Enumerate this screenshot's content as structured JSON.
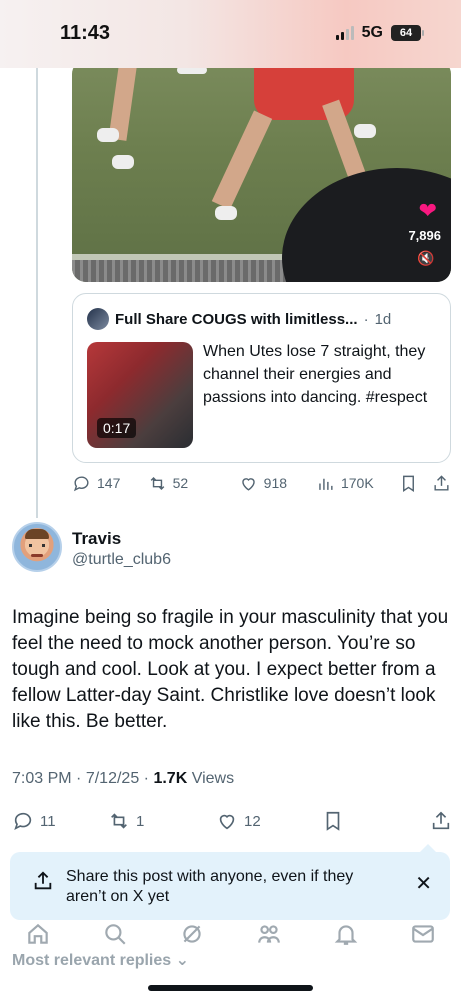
{
  "status_bar": {
    "time": "11:43",
    "network": "5G",
    "battery": "64"
  },
  "video": {
    "view_count": "7,896"
  },
  "quoted_tweet": {
    "name": "Full Share COUGS with limitless...",
    "separator": "·",
    "time": "1d",
    "duration": "0:17",
    "text": "When Utes lose 7 straight, they channel their energies and passions into dancing. #respect"
  },
  "parent_actions": {
    "replies": "147",
    "reposts": "52",
    "likes": "918",
    "views": "170K"
  },
  "reply": {
    "name": "Travis",
    "handle": "@turtle_club6",
    "text": "Imagine being so fragile in your masculinity that you feel the need to mock another person. You’re so tough and cool. Look at you. I expect better from a fellow Latter-day Saint. Christlike love doesn’t look like this. Be better.",
    "time": "7:03 PM",
    "date": "7/12/25",
    "dot": "·",
    "views_count": "1.7K",
    "views_label": "Views"
  },
  "reply_actions": {
    "replies": "11",
    "reposts": "1",
    "likes": "12"
  },
  "share_tip": {
    "text": "Share this post with anyone, even if they aren’t on X yet",
    "close": "✕"
  },
  "sort": {
    "label": "Most relevant replies",
    "chevron": "⌄"
  },
  "colors": {
    "like_red": "#f91880",
    "text_secondary": "#536471",
    "tip_bg": "#e3f2fb"
  }
}
